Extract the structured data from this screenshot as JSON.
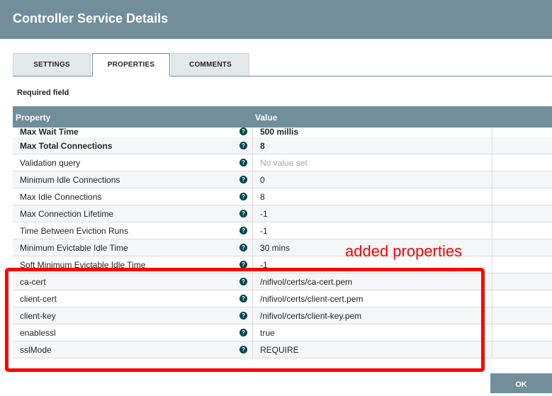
{
  "dialog": {
    "title": "Controller Service Details"
  },
  "tabs": [
    {
      "label": "SETTINGS"
    },
    {
      "label": "PROPERTIES"
    },
    {
      "label": "COMMENTS"
    }
  ],
  "required_label": "Required field",
  "grid": {
    "header": {
      "property": "Property",
      "value": "Value"
    },
    "rows": [
      {
        "name": "Max Wait Time",
        "value": "500 millis"
      },
      {
        "name": "Max Total Connections",
        "value": "8"
      },
      {
        "name": "Validation query",
        "value": "No value set"
      },
      {
        "name": "Minimum Idle Connections",
        "value": "0"
      },
      {
        "name": "Max Idle Connections",
        "value": "8"
      },
      {
        "name": "Max Connection Lifetime",
        "value": "-1"
      },
      {
        "name": "Time Between Eviction Runs",
        "value": "-1"
      },
      {
        "name": "Minimum Evictable Idle Time",
        "value": "30 mins"
      },
      {
        "name": "Soft Minimum Evictable Idle Time",
        "value": "-1"
      },
      {
        "name": "ca-cert",
        "value": "/nifivol/certs/ca-cert.pem"
      },
      {
        "name": "client-cert",
        "value": "/nifivol/certs/client-cert.pem"
      },
      {
        "name": "client-key",
        "value": "/nifivol/certs/client-key.pem"
      },
      {
        "name": "enablessl",
        "value": "true"
      },
      {
        "name": "sslMode",
        "value": "REQUIRE"
      }
    ]
  },
  "annotation": {
    "text": "added properties",
    "color": "#ff0000"
  },
  "buttons": {
    "ok": "OK"
  },
  "colors": {
    "header": "#728e9b",
    "help_icon": "#004849"
  },
  "icons": {
    "help": "question-circle-icon"
  }
}
